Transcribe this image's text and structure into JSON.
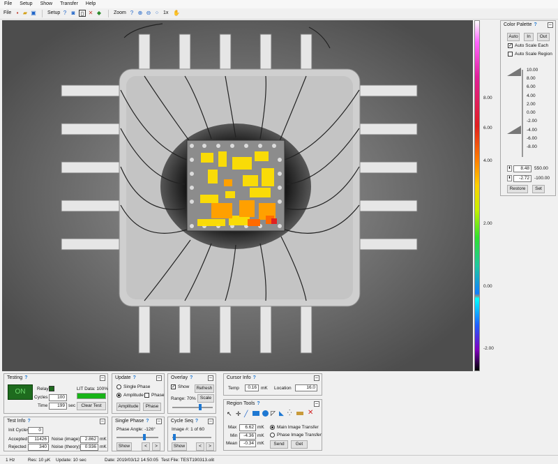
{
  "menu": [
    "File",
    "Setup",
    "Show",
    "Transfer",
    "Help"
  ],
  "toolbar": {
    "file_label": "File",
    "setup_label": "Setup",
    "zoom_label": "Zoom",
    "zoom_level": "1x"
  },
  "scale_ticks": [
    "8.00",
    "6.00",
    "4.00",
    "2.00",
    "0.00",
    "-2.00"
  ],
  "color_palette": {
    "title": "Color Palette",
    "auto_btn": "Auto",
    "in_btn": "In",
    "out_btn": "Out",
    "auto_scale_each": "Auto Scale Each",
    "auto_scale_each_checked": true,
    "auto_scale_region": "Auto Scale Region",
    "auto_scale_region_checked": false,
    "ticks": [
      "10.00",
      "8.00",
      "6.00",
      "4.00",
      "2.00",
      "0.00",
      "-2.00",
      "-4.00",
      "-6.00",
      "-8.00"
    ],
    "max_value": "8.48",
    "max_extra": "550.00",
    "min_value": "-2.72",
    "min_extra": "-100.00",
    "restore_btn": "Restore",
    "set_btn": "Set"
  },
  "testing": {
    "title": "Testing",
    "on_label": "ON",
    "relay_label": "Relay",
    "cycles_label": "Cycles",
    "cycles_value": "100",
    "time_label": "Time",
    "time_value": "199",
    "time_unit": "sec",
    "lit_data_label": "LIT Data: 100%",
    "lit_progress": 1.0,
    "clear_test_btn": "Clear Test"
  },
  "update": {
    "title": "Update",
    "single_phase": "Single Phase",
    "amplitude": "Amplitude",
    "phase_chk": "Phase",
    "amplitude_btn": "Amplitude",
    "phase_btn": "Phase"
  },
  "overlay": {
    "title": "Overlay",
    "show_label": "Show",
    "refresh_btn": "Refresh",
    "scale_btn": "Scale",
    "range_label": "Range: 70%"
  },
  "cursor_info": {
    "title": "Cursor Info",
    "temp_label": "Temp",
    "temp_value": "0.16",
    "temp_unit": "mK",
    "location_label": "Location",
    "location_value": "16.0"
  },
  "region_tools": {
    "title": "Region Tools",
    "max_label": "Max",
    "max_value": "6.62",
    "min_label": "Min",
    "min_value": "-4.36",
    "mean_label": "Mean",
    "mean_value": "-0.34",
    "unit": "mK",
    "main_transfer": "Main Image Transfer",
    "phase_transfer": "Phase Image Transfer",
    "send_btn": "Send",
    "get_btn": "Get"
  },
  "test_info": {
    "title": "Test Info",
    "init_cycles_label": "Init Cycles",
    "init_cycles_value": "0",
    "accepted_label": "Accepted",
    "accepted_value": "11426",
    "rejected_label": "Rejected",
    "rejected_value": "340",
    "noise_image_label": "Noise (image)",
    "noise_image_value": "2.862",
    "noise_theory_label": "Noise (theory)",
    "noise_theory_value": "0.936",
    "unit": "mK"
  },
  "single_phase": {
    "title": "Single Phase",
    "angle_label": "Phase Angle: -126°",
    "show_btn": "Show",
    "prev_btn": "<",
    "next_btn": ">"
  },
  "cycle_seq": {
    "title": "Cycle Seq",
    "image_label": "Image #: 1 of 60",
    "show_btn": "Show",
    "prev_btn": "<",
    "next_btn": ">"
  },
  "status": {
    "freq": "1 Hz",
    "res": "Res:  10 µK",
    "update": "Update:  10 sec",
    "date": "Date:  2019/03/12  14:50:05",
    "test_file": "Test File:  TEST190313.olit"
  },
  "help_glyph": "?",
  "min_glyph": "–"
}
